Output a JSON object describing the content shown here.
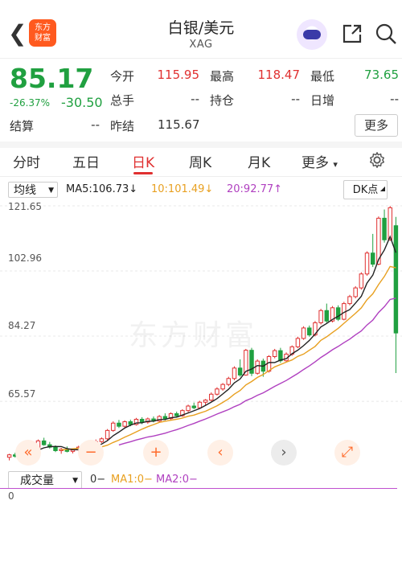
{
  "header": {
    "back_icon": "chevron-left-icon",
    "logo_line1": "东方",
    "logo_line2": "财富",
    "title": "白银/美元",
    "subtitle": "XAG",
    "share_icon": "share-icon",
    "search_icon": "search-icon"
  },
  "quote": {
    "price": "85.17",
    "change_pct": "-26.37%",
    "change": "-30.50",
    "fields": {
      "open_label": "今开",
      "open": "115.95",
      "high_label": "最高",
      "high": "118.47",
      "low_label": "最低",
      "low": "73.65",
      "volume_label": "总手",
      "volume": "--",
      "position_label": "持仓",
      "position": "--",
      "daily_add_label": "日增",
      "daily_add": "--",
      "settle_label": "结算",
      "settle": "--",
      "prev_settle_label": "昨结",
      "prev_settle": "115.67"
    },
    "more_button": "更多"
  },
  "tabs": [
    {
      "label": "分时",
      "active": false
    },
    {
      "label": "五日",
      "active": false
    },
    {
      "label": "日K",
      "active": true
    },
    {
      "label": "周K",
      "active": false
    },
    {
      "label": "月K",
      "active": false
    },
    {
      "label": "更多",
      "active": false
    }
  ],
  "tab_more_arrow": "▾",
  "settings_icon": "gear-icon",
  "indicator_bar": {
    "selector": "均线",
    "ma5": "MA5:106.73↓",
    "ma10": "10:101.49↓",
    "ma20": "20:92.77↑",
    "dk_button": "DK点"
  },
  "colors": {
    "up": "#e03030",
    "down": "#20a040",
    "ma5": "#222222",
    "ma10": "#e8a020",
    "ma20": "#b040c0"
  },
  "chart_data": {
    "type": "candlestick",
    "ylim": [
      46.9,
      123.5
    ],
    "y_ticks": [
      "121.65",
      "102.96",
      "84.27",
      "65.57"
    ],
    "watermark": "东方财富",
    "candles": [
      [
        49.5,
        50.5,
        48.6,
        50.2
      ],
      [
        50.2,
        50.8,
        49.4,
        49.8
      ],
      [
        49.8,
        51.0,
        49.5,
        50.6
      ],
      [
        50.6,
        51.6,
        50.1,
        51.2
      ],
      [
        51.2,
        52.3,
        50.8,
        51.9
      ],
      [
        51.9,
        54.6,
        51.6,
        54.2
      ],
      [
        54.2,
        55.1,
        52.8,
        53.1
      ],
      [
        53.1,
        53.9,
        52.0,
        52.4
      ],
      [
        52.4,
        52.9,
        51.0,
        51.4
      ],
      [
        51.4,
        52.2,
        50.5,
        51.8
      ],
      [
        51.8,
        52.6,
        50.9,
        51.2
      ],
      [
        51.2,
        51.9,
        50.6,
        51.6
      ],
      [
        51.6,
        52.8,
        51.2,
        52.4
      ],
      [
        52.4,
        53.3,
        51.9,
        52.1
      ],
      [
        52.1,
        53.6,
        51.8,
        53.2
      ],
      [
        53.2,
        54.6,
        52.9,
        54.0
      ],
      [
        54.0,
        55.2,
        53.6,
        54.8
      ],
      [
        54.8,
        57.6,
        54.3,
        57.2
      ],
      [
        57.2,
        59.8,
        56.8,
        59.3
      ],
      [
        59.3,
        60.2,
        57.9,
        58.4
      ],
      [
        58.4,
        60.1,
        58.0,
        59.7
      ],
      [
        59.7,
        60.3,
        58.4,
        58.9
      ],
      [
        58.9,
        60.8,
        58.6,
        60.4
      ],
      [
        60.4,
        61.0,
        59.0,
        59.6
      ],
      [
        59.6,
        60.9,
        59.1,
        60.5
      ],
      [
        60.5,
        61.2,
        59.5,
        59.9
      ],
      [
        59.9,
        61.6,
        59.5,
        61.2
      ],
      [
        61.2,
        62.1,
        60.1,
        60.6
      ],
      [
        60.6,
        62.4,
        60.2,
        62.0
      ],
      [
        62.0,
        62.6,
        60.9,
        61.4
      ],
      [
        61.4,
        63.3,
        61.1,
        62.9
      ],
      [
        62.9,
        64.6,
        62.4,
        64.2
      ],
      [
        64.2,
        65.2,
        63.3,
        63.7
      ],
      [
        63.7,
        65.7,
        63.4,
        65.3
      ],
      [
        65.3,
        66.2,
        64.5,
        65.9
      ],
      [
        65.9,
        68.1,
        65.5,
        67.6
      ],
      [
        67.6,
        69.6,
        67.2,
        69.1
      ],
      [
        69.1,
        70.8,
        68.6,
        70.4
      ],
      [
        70.4,
        72.6,
        69.9,
        72.1
      ],
      [
        72.1,
        75.6,
        71.6,
        75.1
      ],
      [
        75.1,
        77.6,
        72.6,
        73.1
      ],
      [
        73.1,
        80.6,
        72.9,
        80.2
      ],
      [
        80.2,
        80.9,
        72.8,
        73.6
      ],
      [
        73.6,
        77.6,
        73.2,
        77.1
      ],
      [
        77.1,
        77.8,
        72.6,
        74.2
      ],
      [
        74.2,
        78.8,
        73.8,
        78.4
      ],
      [
        78.4,
        80.6,
        77.9,
        80.1
      ],
      [
        80.1,
        80.9,
        76.6,
        77.2
      ],
      [
        77.2,
        79.6,
        76.8,
        79.1
      ],
      [
        79.1,
        81.6,
        78.6,
        81.2
      ],
      [
        81.2,
        84.1,
        80.8,
        83.6
      ],
      [
        83.6,
        87.1,
        83.2,
        86.6
      ],
      [
        86.6,
        87.3,
        84.1,
        84.6
      ],
      [
        84.6,
        88.6,
        84.2,
        88.1
      ],
      [
        88.1,
        92.1,
        87.6,
        91.6
      ],
      [
        91.6,
        93.6,
        88.1,
        88.6
      ],
      [
        88.6,
        92.9,
        88.2,
        92.4
      ],
      [
        92.4,
        93.1,
        88.6,
        89.1
      ],
      [
        89.1,
        94.1,
        88.8,
        93.6
      ],
      [
        93.6,
        96.1,
        93.1,
        95.6
      ],
      [
        95.6,
        98.6,
        95.1,
        98.1
      ],
      [
        98.1,
        102.6,
        97.6,
        102.1
      ],
      [
        102.1,
        108.6,
        101.6,
        108.1
      ],
      [
        108.1,
        113.6,
        104.1,
        104.9
      ],
      [
        104.9,
        118.6,
        104.6,
        118.1
      ],
      [
        118.1,
        120.6,
        111.1,
        111.9
      ],
      [
        111.9,
        121.6,
        111.6,
        121.1
      ],
      [
        115.95,
        118.47,
        73.65,
        85.17
      ]
    ],
    "volume_ylabel": "0"
  },
  "controls": {
    "rewind": "«",
    "zoom_out": "−",
    "zoom_in": "+",
    "prev": "‹",
    "next": "›",
    "fullscreen": "⤢"
  },
  "volume_bar": {
    "selector": "成交量",
    "value": "0−",
    "ma1": "MA1:0−",
    "ma2": "MA2:0−",
    "axis_zero": "0"
  }
}
